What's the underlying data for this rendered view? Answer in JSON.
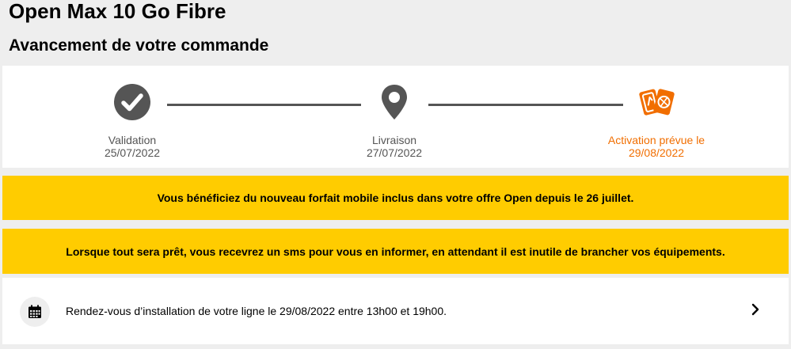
{
  "header": {
    "title": "Open Max 10 Go Fibre",
    "subtitle": "Avancement de votre commande"
  },
  "tracker": {
    "steps": [
      {
        "name": "Validation",
        "date": "25/07/2022",
        "icon": "check-circle-icon",
        "status": "done"
      },
      {
        "name": "Livraison",
        "date": "27/07/2022",
        "icon": "location-pin-icon",
        "status": "pending"
      },
      {
        "name": "Activation prévue le",
        "date": "29/08/2022",
        "icon": "activation-cards-icon",
        "status": "current"
      }
    ],
    "colors": {
      "done": "#555555",
      "pending": "#555555",
      "current": "#f16e00"
    }
  },
  "banners": [
    "Vous bénéficiez du nouveau forfait mobile inclus dans votre offre Open depuis le 26 juillet.",
    "Lorsque tout sera prêt, vous recevrez un sms pour vous en informer, en attendant il est inutile de brancher vos équipements."
  ],
  "appointment": {
    "icon": "calendar-icon",
    "text": "Rendez-vous d’installation de votre ligne le 29/08/2022 entre 13h00 et 19h00.",
    "action_icon": "chevron-right-icon"
  },
  "colors": {
    "accent": "#f16e00",
    "banner": "#ffcc00",
    "background": "#eeeeee"
  }
}
